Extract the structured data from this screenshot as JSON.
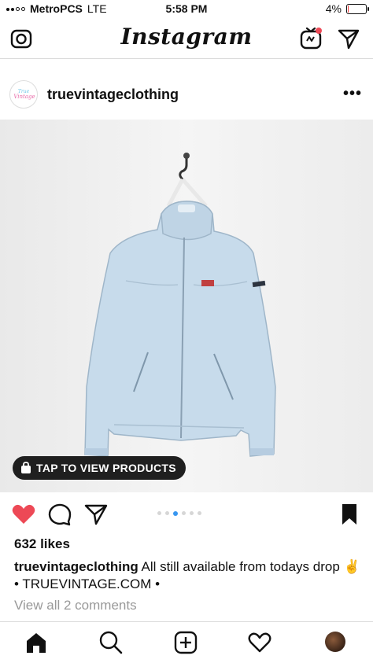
{
  "status_bar": {
    "carrier": "MetroPCS",
    "network": "LTE",
    "time": "5:58 PM",
    "battery_percent": "4%",
    "battery_level": 0.04
  },
  "top_nav": {
    "logo": "Instagram"
  },
  "post": {
    "username": "truevintageclothing",
    "avatar_text": "True Vintage",
    "product_tag": "TAP TO VIEW PRODUCTS",
    "carousel": {
      "total": 6,
      "active": 2
    },
    "likes": "632 likes",
    "caption_user": "truevintageclothing",
    "caption_text": " All still available from todays drop ✌️ • TRUEVINTAGE.COM •",
    "view_comments": "View all 2 comments"
  },
  "colors": {
    "like_red": "#ed4956",
    "carousel_active": "#3897f0",
    "pill_bg": "#1f1f1f",
    "jacket": "#c7dbeb"
  },
  "icons": {
    "top": [
      "camera-icon",
      "igtv-icon",
      "direct-send-icon"
    ],
    "actions": [
      "heart-filled-icon",
      "comment-icon",
      "share-send-icon",
      "bookmark-icon"
    ],
    "tabs": [
      "home-icon",
      "search-icon",
      "add-post-icon",
      "activity-heart-icon",
      "profile-avatar"
    ]
  }
}
